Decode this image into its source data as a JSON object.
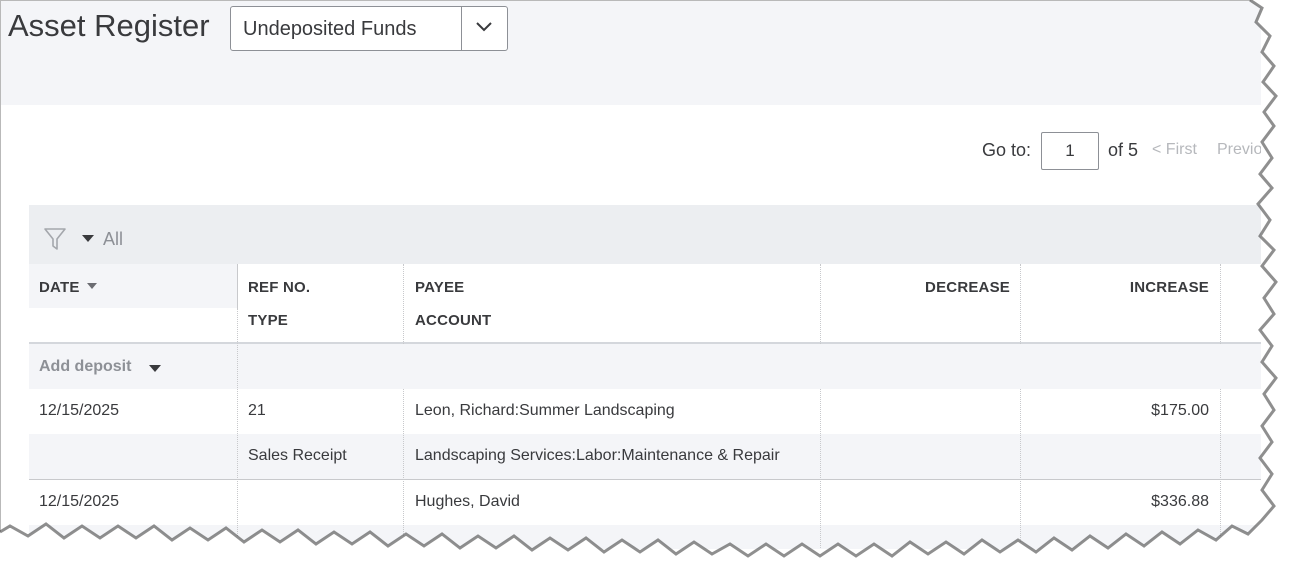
{
  "page": {
    "title": "Asset Register",
    "account_select": {
      "value": "Undeposited Funds",
      "icon": "chevron-down-icon"
    }
  },
  "pager": {
    "goto_label": "Go to:",
    "current_page": "1",
    "of_pages": "of 5",
    "first_label": "< First",
    "previous_label": "Previo"
  },
  "filter": {
    "icon": "funnel-icon",
    "value": "All"
  },
  "table": {
    "headers": {
      "date": "DATE",
      "ref_no": "REF NO.",
      "type": "TYPE",
      "payee": "PAYEE",
      "account": "ACCOUNT",
      "decrease": "DECREASE",
      "increase": "INCREASE"
    },
    "add_deposit_label": "Add deposit",
    "transactions": [
      {
        "date": "12/15/2025",
        "ref_no": "21",
        "type": "Sales Receipt",
        "payee": "Leon, Richard:Summer Landscaping",
        "account": "Landscaping Services:Labor:Maintenance & Repair",
        "decrease": "",
        "increase": "$175.00"
      },
      {
        "date": "12/15/2025",
        "ref_no": "",
        "type": "",
        "payee": "Hughes, David",
        "account": "",
        "decrease": "",
        "increase": "$336.88"
      }
    ]
  },
  "colors": {
    "header_band": "#f4f5f8",
    "filter_bar": "#eceef1",
    "text": "#393a3d",
    "muted": "#8d9096",
    "disabled": "#b6b8bc"
  }
}
